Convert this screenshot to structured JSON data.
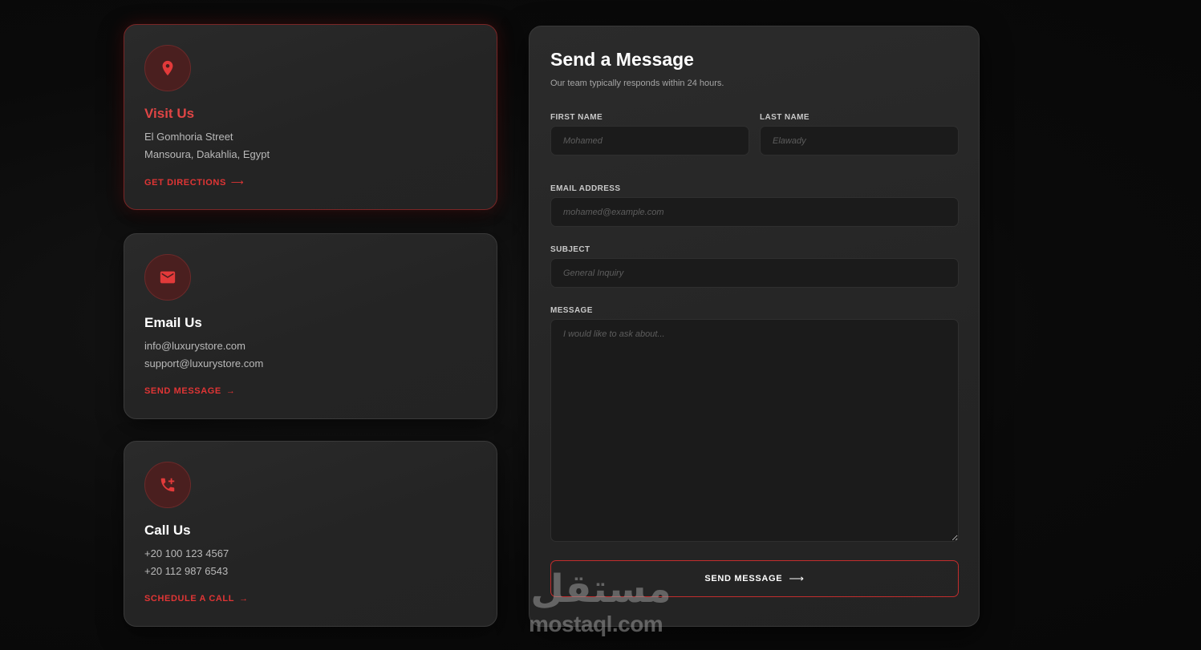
{
  "cards": [
    {
      "icon": "location-pin-icon",
      "title": "Visit Us",
      "line1": "El Gomhoria Street",
      "line2": "Mansoura, Dakahlia, Egypt",
      "link": "GET DIRECTIONS",
      "arrow": "⟶"
    },
    {
      "icon": "mail-icon",
      "title": "Email Us",
      "line1": "info@luxurystore.com",
      "line2": "support@luxurystore.com",
      "link": "SEND MESSAGE",
      "arrow": "→"
    },
    {
      "icon": "phone-add-icon",
      "title": "Call Us",
      "line1": "+20 100 123 4567",
      "line2": "+20 112 987 6543",
      "link": "SCHEDULE A CALL",
      "arrow": "→"
    }
  ],
  "form": {
    "title": "Send a Message",
    "subtitle": "Our team typically responds within 24 hours.",
    "first_name": {
      "label": "FIRST NAME",
      "placeholder": "Mohamed",
      "value": ""
    },
    "last_name": {
      "label": "LAST NAME",
      "placeholder": "Elawady",
      "value": ""
    },
    "email": {
      "label": "EMAIL ADDRESS",
      "placeholder": "mohamed@example.com",
      "value": ""
    },
    "subject": {
      "label": "SUBJECT",
      "placeholder": "General Inquiry",
      "value": ""
    },
    "message": {
      "label": "MESSAGE",
      "placeholder": "I would like to ask about...",
      "value": ""
    },
    "submit_label": "SEND MESSAGE",
    "submit_arrow": "⟶"
  },
  "watermark": {
    "arabic_logo": "مستقل",
    "text": "mostaql.com"
  },
  "colors": {
    "accent": "#e03535",
    "background": "#0b0b0b",
    "card": "#262626"
  }
}
